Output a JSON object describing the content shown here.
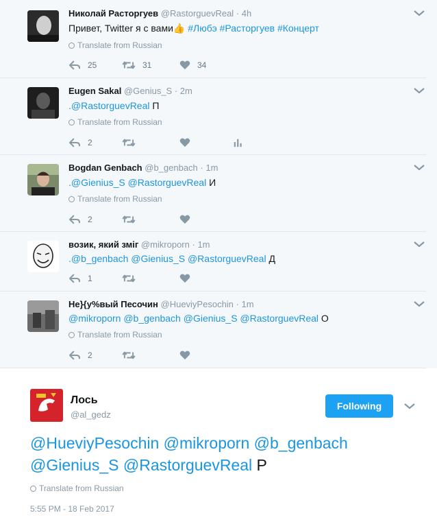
{
  "tweets": [
    {
      "name": "Николай Расторгуев",
      "handle": "@RastorguevReal",
      "dot": " · ",
      "time": "4h",
      "text": "Привет, Twitter я с вами👍 ",
      "hashtags": "#Любэ #Расторгуев #Концерт",
      "translate": "Translate from Russian",
      "reply_count": "25",
      "retweet_count": "31",
      "like_count": "34"
    },
    {
      "name": "Eugen Sakal",
      "handle": "@Genius_S",
      "dot": " · ",
      "time": "2m",
      "mention": ".@RastorguevReal",
      "text": " П",
      "translate": "Translate from Russian",
      "reply_count": "2"
    },
    {
      "name": "Bogdan Genbach",
      "handle": "@b_genbach",
      "dot": " · ",
      "time": "1m",
      "mention": ".@Gienius_S @RastorguevReal",
      "text": " И",
      "translate": "Translate from Russian",
      "reply_count": "2"
    },
    {
      "name": "возик, який зміг",
      "handle": "@mikroporn",
      "dot": " · ",
      "time": "1m",
      "mention": ".@b_genbach @Gienius_S @RastorguevReal",
      "text": " Д",
      "reply_count": "1"
    },
    {
      "name": "Не}{у%вый Песочин",
      "handle": "@HueviyPesochin",
      "dot": " · ",
      "time": "1m",
      "mention": "@mikroporn @b_genbach @Gienius_S @RastorguevReal",
      "text": " О",
      "translate": "Translate from Russian",
      "reply_count": "2"
    }
  ],
  "focus": {
    "name": "Лось",
    "handle": "@al_gedz",
    "follow_label": "Following",
    "line1": "@HueviyPesochin @mikroporn @b_genbach",
    "line2_mention": "@Gienius_S @RastorguevReal",
    "line2_text": " Р",
    "translate": "Translate from Russian",
    "timestamp": "5:55 PM - 18 Feb 2017"
  },
  "colors": {
    "accent": "#1b95e0",
    "button": "#1da1f2",
    "muted": "#8899a6",
    "background": "#f5f8fa"
  }
}
